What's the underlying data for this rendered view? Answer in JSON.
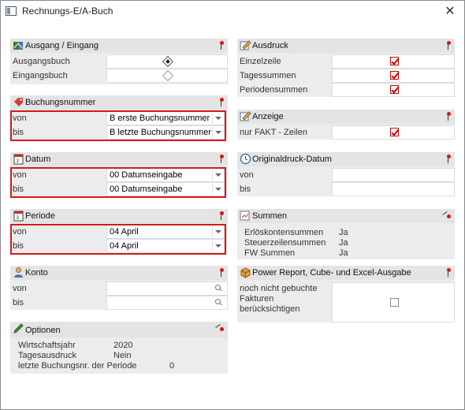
{
  "window": {
    "title": "Rechnungs-E/A-Buch",
    "close": "✕"
  },
  "ausgang": {
    "title": "Ausgang / Eingang",
    "rows": [
      {
        "label": "Ausgangsbuch",
        "selected": true
      },
      {
        "label": "Eingangsbuch",
        "selected": false
      }
    ]
  },
  "buchungsnummer": {
    "title": "Buchungsnummer",
    "from_label": "von",
    "from_value": "B erste Buchungsnummer",
    "to_label": "bis",
    "to_value": "B letzte Buchungsnummer"
  },
  "datum": {
    "title": "Datum",
    "from_label": "von",
    "from_value": "00 Datumseingabe",
    "to_label": "bis",
    "to_value": "00 Datumseingabe"
  },
  "periode": {
    "title": "Periode",
    "from_label": "von",
    "from_value": "04 April",
    "to_label": "bis",
    "to_value": "04 April"
  },
  "konto": {
    "title": "Konto",
    "from_label": "von",
    "from_value": "",
    "to_label": "bis",
    "to_value": ""
  },
  "optionen": {
    "title": "Optionen",
    "items": [
      {
        "label": "Wirtschaftsjahr",
        "value": "2020"
      },
      {
        "label": "Tagesausdruck",
        "value": "Nein"
      },
      {
        "label": "letzte Buchungsnr. der Periode",
        "value": "0"
      }
    ]
  },
  "ausdruck": {
    "title": "Ausdruck",
    "rows": [
      {
        "label": "Einzelzeile",
        "checked": true
      },
      {
        "label": "Tagessummen",
        "checked": true
      },
      {
        "label": "Periodensummen",
        "checked": true
      }
    ]
  },
  "anzeige": {
    "title": "Anzeige",
    "rows": [
      {
        "label": "nur FAKT - Zeilen",
        "checked": true
      }
    ]
  },
  "originaldruck": {
    "title": "Originaldruck-Datum",
    "from_label": "von",
    "from_value": "",
    "to_label": "bis",
    "to_value": ""
  },
  "summen": {
    "title": "Summen",
    "items": [
      {
        "label": "Erlöskontensummen",
        "value": "Ja"
      },
      {
        "label": "Steuerzeilensummen",
        "value": "Ja"
      },
      {
        "label": "FW Summen",
        "value": "Ja"
      }
    ]
  },
  "powerreport": {
    "title": "Power Report, Cube- und Excel-Ausgabe",
    "label_line1": "noch nicht gebuchte",
    "label_line2": "Fakturen",
    "label_line3": "berücksichtigen",
    "checked": false
  },
  "colors": {
    "accent_red": "#d11b1b",
    "panel": "#ececec",
    "header": "#e4e4e4"
  }
}
